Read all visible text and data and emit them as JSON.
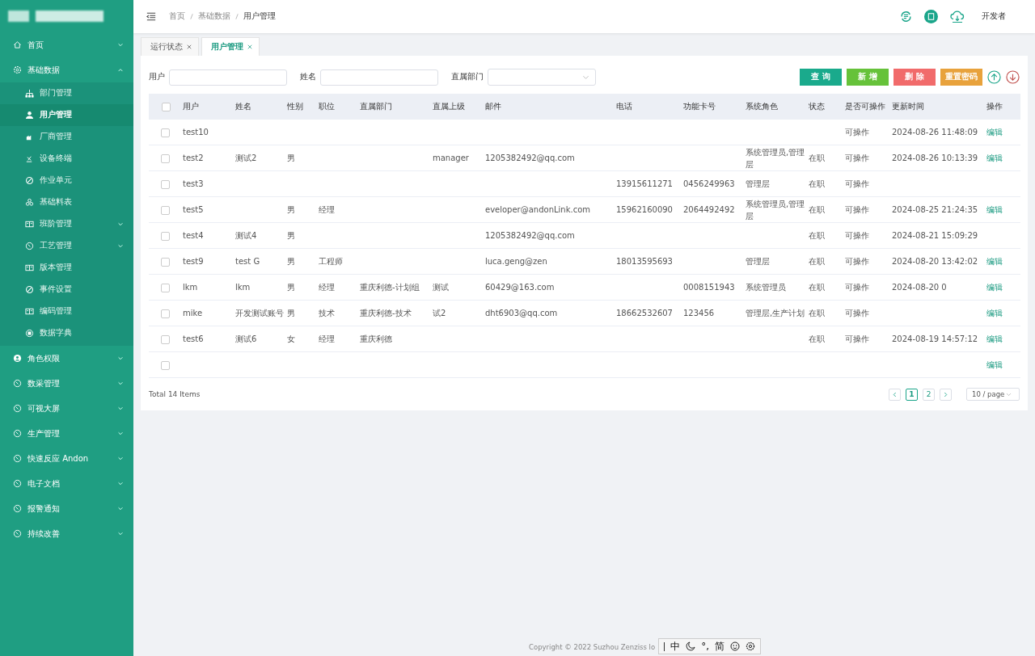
{
  "sidebar": {
    "items": [
      {
        "label": "首页",
        "expanded": false,
        "selected": false
      },
      {
        "label": "基础数据",
        "expanded": true,
        "selected": false,
        "children": [
          {
            "label": "部门管理",
            "selected": false,
            "has_submenu": false
          },
          {
            "label": "用户管理",
            "selected": true,
            "has_submenu": false
          },
          {
            "label": "厂商管理",
            "selected": false,
            "has_submenu": false
          },
          {
            "label": "设备终端",
            "selected": false,
            "has_submenu": false
          },
          {
            "label": "作业单元",
            "selected": false,
            "has_submenu": false
          },
          {
            "label": "基础料表",
            "selected": false,
            "has_submenu": false
          },
          {
            "label": "班阶管理",
            "selected": false,
            "has_submenu": true
          },
          {
            "label": "工艺管理",
            "selected": false,
            "has_submenu": true
          },
          {
            "label": "版本管理",
            "selected": false,
            "has_submenu": false
          },
          {
            "label": "事件设置",
            "selected": false,
            "has_submenu": false
          },
          {
            "label": "编码管理",
            "selected": false,
            "has_submenu": false
          },
          {
            "label": "数据字典",
            "selected": false,
            "has_submenu": false
          }
        ]
      },
      {
        "label": "角色权限",
        "expanded": false,
        "selected": false
      },
      {
        "label": "数采管理",
        "expanded": false,
        "selected": false
      },
      {
        "label": "可视大屏",
        "expanded": false,
        "selected": false
      },
      {
        "label": "生产管理",
        "expanded": false,
        "selected": false
      },
      {
        "label": "快速反应 Andon",
        "expanded": false,
        "selected": false
      },
      {
        "label": "电子文档",
        "expanded": false,
        "selected": false
      },
      {
        "label": "报警通知",
        "expanded": false,
        "selected": false
      },
      {
        "label": "持续改善",
        "expanded": false,
        "selected": false
      }
    ]
  },
  "breadcrumb": [
    "首页",
    "基础数据",
    "用户管理"
  ],
  "header": {
    "user": "开发者"
  },
  "tabs": [
    {
      "label": "运行状态",
      "selected": false
    },
    {
      "label": "用户管理",
      "selected": true
    }
  ],
  "filters": [
    {
      "label": "用户",
      "kind": "input"
    },
    {
      "label": "姓名",
      "kind": "input"
    },
    {
      "label": "直属部门",
      "kind": "select"
    }
  ],
  "buttons": [
    {
      "label": "查 询",
      "kind": "query"
    },
    {
      "label": "新 增",
      "kind": "add"
    },
    {
      "label": "删 除",
      "kind": "delete"
    },
    {
      "label": "重置密码",
      "kind": "reset"
    }
  ],
  "table": {
    "all_checked": false,
    "columns": [
      "用户",
      "姓名",
      "性别",
      "职位",
      "直属部门",
      "直属上级",
      "邮件",
      "电话",
      "功能卡号",
      "系统角色",
      "状态",
      "是否可操作",
      "更新时间",
      "操作"
    ],
    "rows": [
      {
        "checked": false,
        "cells": [
          "test10",
          null,
          null,
          null,
          null,
          null,
          null,
          null,
          null,
          null,
          null,
          "可操作",
          "2024-08-26 11:48:09",
          "编辑"
        ]
      },
      {
        "checked": false,
        "cells": [
          "test2",
          "测试2",
          "男",
          null,
          null,
          "manager",
          "1205382492@qq.com",
          null,
          null,
          "系统管理员,管理层",
          "在职",
          "可操作",
          "2024-08-26 10:13:39",
          "编辑"
        ]
      },
      {
        "checked": false,
        "cells": [
          "test3",
          null,
          null,
          null,
          null,
          null,
          null,
          "13915611271",
          "0456249963",
          "管理层",
          "在职",
          "可操作",
          null,
          null
        ]
      },
      {
        "checked": false,
        "cells": [
          "test5",
          null,
          "男",
          "经理",
          null,
          null,
          "eveloper@andonLink.com",
          "15962160090",
          "2064492492",
          "系统管理员,管理层",
          "在职",
          "可操作",
          "2024-08-25 21:24:35",
          "编辑"
        ]
      },
      {
        "checked": false,
        "cells": [
          "test4",
          "测试4",
          "男",
          null,
          null,
          null,
          "1205382492@qq.com",
          null,
          null,
          null,
          "在职",
          "可操作",
          "2024-08-21 15:09:29",
          null
        ]
      },
      {
        "checked": false,
        "cells": [
          "test9",
          "test G",
          "男",
          "工程师",
          null,
          null,
          "luca.geng@zen",
          "18013595693",
          null,
          "管理层",
          "在职",
          "可操作",
          "2024-08-20 13:42:02",
          "编辑"
        ]
      },
      {
        "checked": false,
        "cells": [
          "lkm",
          "lkm",
          "男",
          "经理",
          "重庆利德-计划组",
          "测试",
          "60429@163.com",
          null,
          "0008151943",
          "系统管理员",
          "在职",
          "可操作",
          "2024-08-20 0",
          "编辑"
        ]
      },
      {
        "checked": false,
        "cells": [
          "mike",
          "开发测试账号",
          "男",
          "技术",
          "重庆利德-技术",
          "试2",
          "dht6903@qq.com",
          "18662532607",
          "123456",
          "管理层,生产计划",
          "在职",
          "可操作",
          null,
          "编辑"
        ]
      },
      {
        "checked": false,
        "cells": [
          "test6",
          "测试6",
          "女",
          "经理",
          "重庆利德",
          null,
          null,
          null,
          null,
          null,
          "在职",
          "可操作",
          "2024-08-19 14:57:12",
          "编辑"
        ]
      },
      {
        "checked": false,
        "cells": [
          null,
          null,
          null,
          null,
          null,
          null,
          null,
          null,
          null,
          null,
          null,
          null,
          null,
          "编辑"
        ]
      }
    ]
  },
  "pagination": {
    "total": "Total 14 Items",
    "pages": [
      {
        "label": "1",
        "selected": true
      },
      {
        "label": "2",
        "selected": false
      }
    ],
    "page_size": "10 / page"
  },
  "footer": {
    "copyright": "Copyright © 2022 Suzhou Zenziss lo"
  },
  "ime_toolbar": {
    "items": [
      "中",
      "°,",
      "简"
    ]
  }
}
